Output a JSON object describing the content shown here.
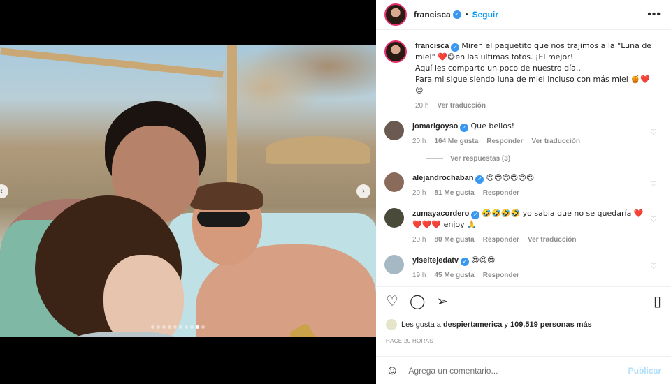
{
  "post": {
    "author": "francisca",
    "follow_label": "Seguir",
    "more_label": "•••",
    "caption_lines": [
      "Miren el paquetito que nos trajimos a la \"Luna de",
      "miel\" ❤️😅en las ultimas fotos. ¡El mejor!",
      "Aquí les comparto un poco de nuestro día..",
      "Para mi sigue siendo luna de miel incluso con más miel 🍯❤️😍"
    ],
    "caption_time": "20 h",
    "caption_translate": "Ver traducción"
  },
  "media": {
    "prev_label": "‹",
    "next_label": "›",
    "dots_total": 10,
    "dots_active_index": 8
  },
  "comments": [
    {
      "user": "jomarigoyso",
      "text": "Que bellos!",
      "time": "20 h",
      "likes": "164 Me gusta",
      "reply": "Responder",
      "translate": "Ver traducción",
      "avatar_color": "#6b5a52",
      "replies_label": "Ver respuestas (3)"
    },
    {
      "user": "alejandrochaban",
      "text": "😍😍😍😍😍😍",
      "time": "20 h",
      "likes": "81 Me gusta",
      "reply": "Responder",
      "translate": "",
      "avatar_color": "#8a6a5a"
    },
    {
      "user": "zumayacordero",
      "text": "🤣🤣🤣🤣 yo sabia que no se quedaría ❤️❤️❤️❤️ enjoy 🙏",
      "time": "20 h",
      "likes": "80 Me gusta",
      "reply": "Responder",
      "translate": "Ver traducción",
      "avatar_color": "#4a4a3a"
    },
    {
      "user": "yiseltejedatv",
      "text": "😍😍😍",
      "time": "19 h",
      "likes": "45 Me gusta",
      "reply": "Responder",
      "translate": "",
      "avatar_color": "#a6b8c4"
    }
  ],
  "likes_line": {
    "prefix": "Les gusta a",
    "user": "despiertamerica",
    "connector": "y",
    "count": "109,519 personas más"
  },
  "posted_ago": "HACE 20 HORAS",
  "composer": {
    "placeholder": "Agrega un comentario...",
    "publish": "Publicar"
  },
  "icons": {
    "heart": "heart-icon",
    "comment": "comment-icon",
    "share": "share-icon",
    "save": "bookmark-icon",
    "emoji": "emoji-icon"
  },
  "colors": {
    "accent": "#0095f6",
    "verified": "#3897f0",
    "muted": "#8e8e8e",
    "publish_disabled": "#b2dffc"
  }
}
